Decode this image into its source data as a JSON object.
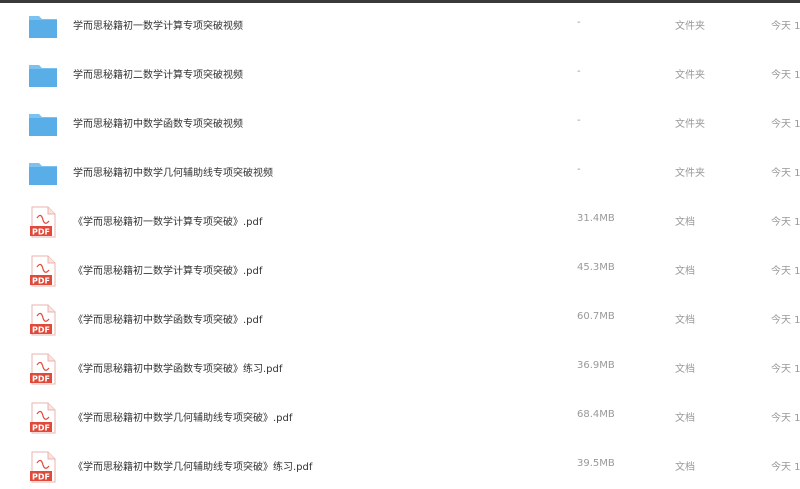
{
  "files": [
    {
      "name": "学而思秘籍初一数学计算专项突破视频",
      "size": "-",
      "type": "文件夹",
      "date": "今天 1",
      "icon": "folder-icon"
    },
    {
      "name": "学而思秘籍初二数学计算专项突破视频",
      "size": "-",
      "type": "文件夹",
      "date": "今天 1",
      "icon": "folder-icon"
    },
    {
      "name": "学而思秘籍初中数学函数专项突破视频",
      "size": "-",
      "type": "文件夹",
      "date": "今天 1",
      "icon": "folder-icon"
    },
    {
      "name": "学而思秘籍初中数学几何辅助线专项突破视频",
      "size": "-",
      "type": "文件夹",
      "date": "今天 1",
      "icon": "folder-icon"
    },
    {
      "name": "《学而思秘籍初一数学计算专项突破》.pdf",
      "size": "31.4MB",
      "type": "文档",
      "date": "今天 1",
      "icon": "pdf-icon"
    },
    {
      "name": "《学而思秘籍初二数学计算专项突破》.pdf",
      "size": "45.3MB",
      "type": "文档",
      "date": "今天 1",
      "icon": "pdf-icon"
    },
    {
      "name": "《学而思秘籍初中数学函数专项突破》.pdf",
      "size": "60.7MB",
      "type": "文档",
      "date": "今天 1",
      "icon": "pdf-icon"
    },
    {
      "name": "《学而思秘籍初中数学函数专项突破》练习.pdf",
      "size": "36.9MB",
      "type": "文档",
      "date": "今天 1",
      "icon": "pdf-icon"
    },
    {
      "name": "《学而思秘籍初中数学几何辅助线专项突破》.pdf",
      "size": "68.4MB",
      "type": "文档",
      "date": "今天 1",
      "icon": "pdf-icon"
    },
    {
      "name": "《学而思秘籍初中数学几何辅助线专项突破》练习.pdf",
      "size": "39.5MB",
      "type": "文档",
      "date": "今天 1",
      "icon": "pdf-icon"
    }
  ],
  "pdf_icon_text": "PDF",
  "colors": {
    "folder": "#5aaee8",
    "folder_tab": "#7cc2f0",
    "pdf_red": "#e04a3a",
    "muted_text": "#999999"
  }
}
